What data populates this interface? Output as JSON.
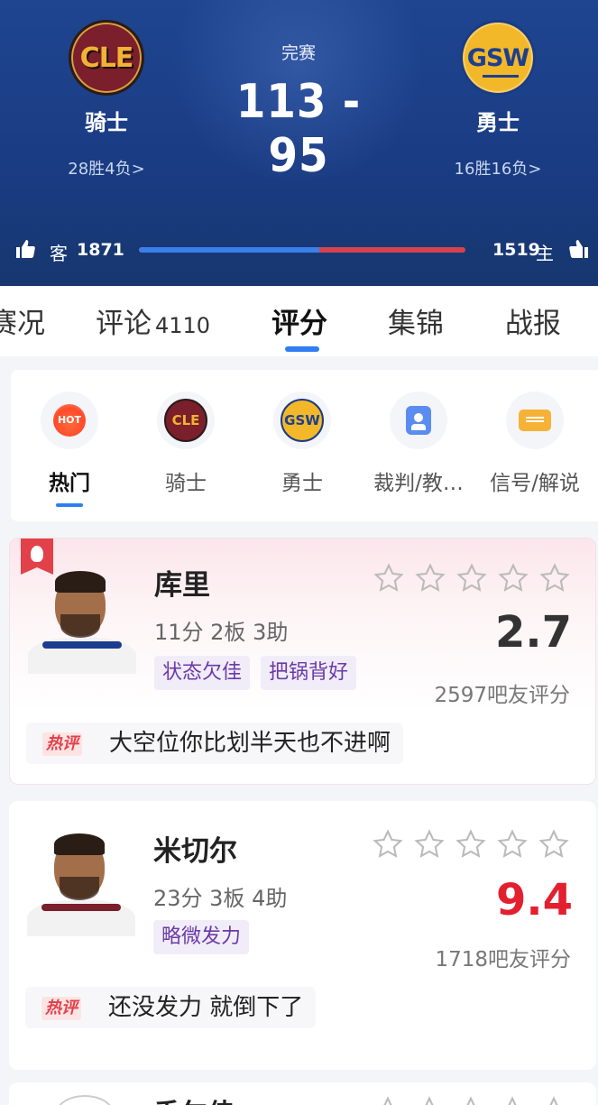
{
  "game": {
    "status": "完赛",
    "score": "113 - 95",
    "away": {
      "abbr": "CLE",
      "name": "骑士",
      "record": "28胜4负>"
    },
    "home": {
      "abbr": "GSW",
      "name": "勇士",
      "record": "16胜16负>"
    }
  },
  "likes": {
    "away_label": "客",
    "away_count": "1871",
    "home_label": "主",
    "home_count": "1519",
    "away_ratio": 0.552,
    "away_color": "#3b80e8",
    "home_color": "#d4434f"
  },
  "tabs": {
    "items": [
      {
        "label": "赛况"
      },
      {
        "label": "评论",
        "count": "4110"
      },
      {
        "label": "评分",
        "active": true
      },
      {
        "label": "集锦"
      },
      {
        "label": "战报"
      }
    ]
  },
  "filters": {
    "items": [
      {
        "label": "热门",
        "icon": "hot-icon",
        "icon_text": "HOT",
        "active": true
      },
      {
        "label": "骑士",
        "icon": "cle-logo-icon",
        "icon_text": "CLE"
      },
      {
        "label": "勇士",
        "icon": "gsw-logo-icon",
        "icon_text": "GSW"
      },
      {
        "label": "裁判/教…",
        "icon": "referee-icon"
      },
      {
        "label": "信号/解说",
        "icon": "camera-icon"
      }
    ]
  },
  "players": [
    {
      "name": "库里",
      "stats": "11分 2板 3助",
      "tags": [
        "状态欠佳",
        "把锅背好"
      ],
      "rating": "2.7",
      "raters": "2597吧友评分",
      "hot_label": "热评",
      "hot_comment": "大空位你比划半天也不进啊",
      "is_hot": true,
      "team_color": "#1c3d8f"
    },
    {
      "name": "米切尔",
      "stats": "23分 3板 4助",
      "tags": [
        "略微发力"
      ],
      "rating": "9.4",
      "raters": "1718吧友评分",
      "hot_label": "热评",
      "hot_comment": "还没发力 就倒下了",
      "is_hot": false,
      "team_color": "#7a1f2b"
    }
  ],
  "partial_player": {
    "name": "香尔佳"
  }
}
